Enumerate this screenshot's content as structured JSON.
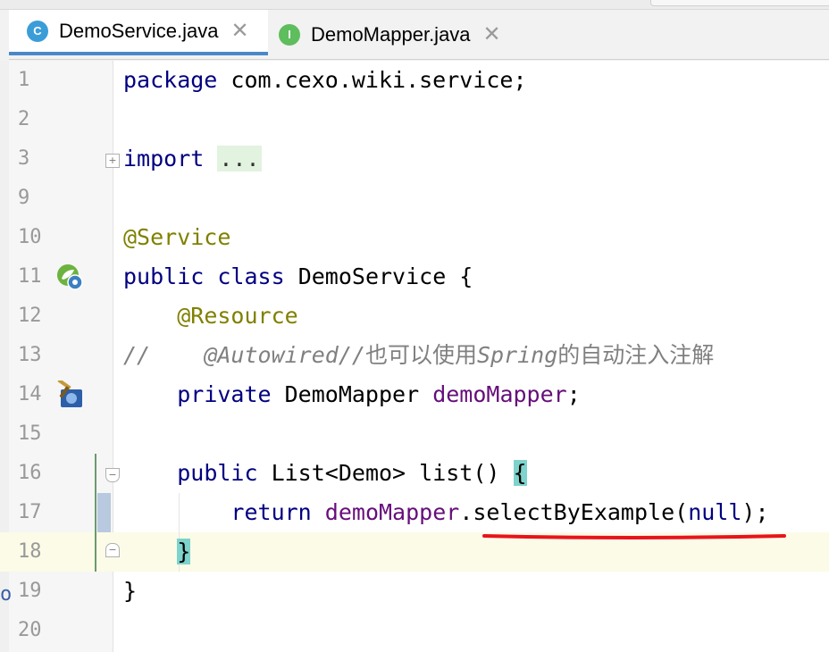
{
  "tabs": [
    {
      "label": "DemoService.java",
      "icon": "C",
      "active": true
    },
    {
      "label": "DemoMapper.java",
      "icon": "I",
      "active": false
    }
  ],
  "tab_close": "✕",
  "side_mark": "o",
  "lines": [
    {
      "no": "1",
      "code": "package com.cexo.wiki.service;"
    },
    {
      "no": "2",
      "code": ""
    },
    {
      "no": "3",
      "code": "import ..."
    },
    {
      "no": "9",
      "code": ""
    },
    {
      "no": "10",
      "code": "@Service"
    },
    {
      "no": "11",
      "code": "public class DemoService {"
    },
    {
      "no": "12",
      "code": "    @Resource"
    },
    {
      "no": "13",
      "code": "//    @Autowired//也可以使用Spring的自动注入注解"
    },
    {
      "no": "14",
      "code": "    private DemoMapper demoMapper;"
    },
    {
      "no": "15",
      "code": ""
    },
    {
      "no": "16",
      "code": "    public List<Demo> list() {"
    },
    {
      "no": "17",
      "code": "        return demoMapper.selectByExample(null);"
    },
    {
      "no": "18",
      "code": "    }"
    },
    {
      "no": "19",
      "code": "}"
    },
    {
      "no": "20",
      "code": ""
    }
  ],
  "tokens": {
    "package_kw": "package",
    "package_name": " com.cexo.wiki.service;",
    "import_kw": "import",
    "import_fold": "...",
    "service_ann": "@Service",
    "public_kw": "public",
    "class_kw": "class",
    "class_name": " DemoService {",
    "resource_ann": "@Resource",
    "comment_prefix": "//    ",
    "comment_ann": "@Autowired//",
    "comment_cn1": "也可以使用",
    "comment_spring": "Spring",
    "comment_cn2": "的自动注入注解",
    "private_kw": "private",
    "field_type": " DemoMapper ",
    "field_name": "demoMapper",
    "semicolon": ";",
    "list_sig": " List<Demo> list() ",
    "open_brace": "{",
    "return_kw": "return",
    "method_call": ".selectByExample(",
    "null_kw": "null",
    "call_end": ");",
    "close_brace": "}"
  },
  "colors": {
    "keyword": "#000080",
    "annotation": "#808000",
    "field": "#660e7a",
    "comment": "#808080",
    "brace_highlight": "#7ed3cc",
    "tab_underline": "#4a88c7",
    "squiggle": "#e8141a"
  }
}
